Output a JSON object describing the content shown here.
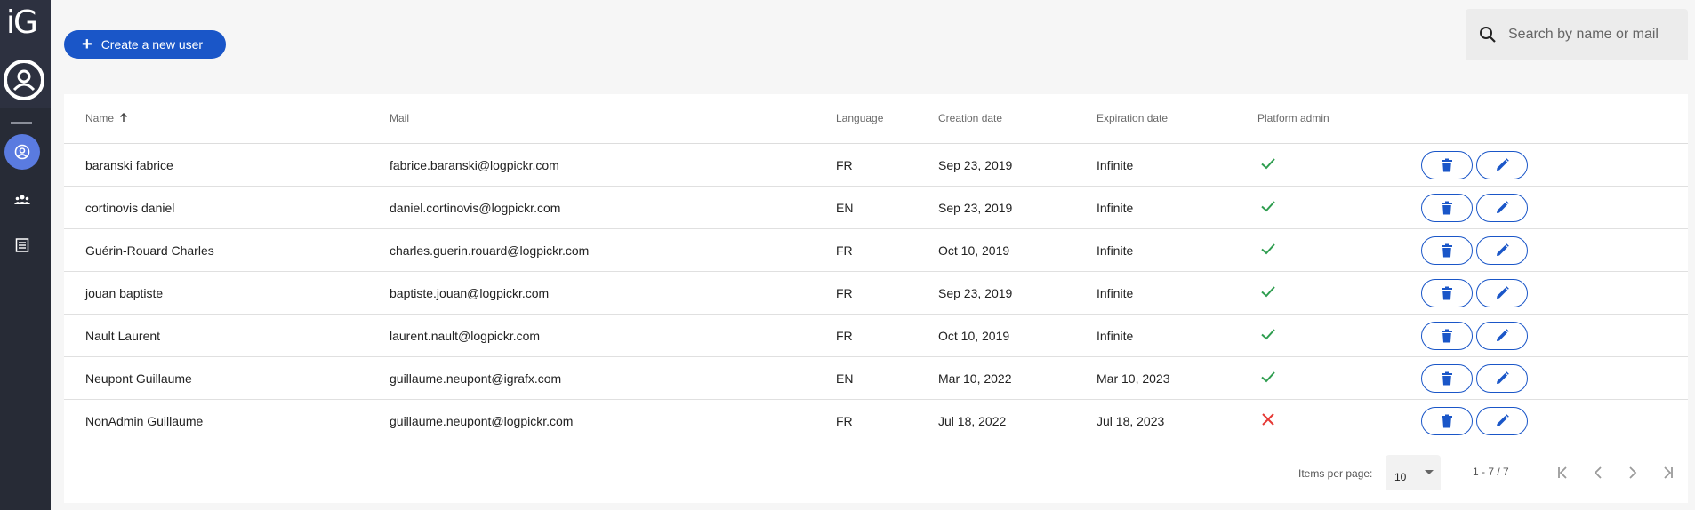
{
  "sidebar": {
    "logo": "iG",
    "items": [
      {
        "icon": "user-circle-icon",
        "active": true
      },
      {
        "icon": "group-icon",
        "active": false
      },
      {
        "icon": "list-icon",
        "active": false
      }
    ]
  },
  "toolbar": {
    "create_label": "Create a new user",
    "search_placeholder": "Search by name or mail"
  },
  "table": {
    "headers": {
      "name": "Name",
      "mail": "Mail",
      "language": "Language",
      "creation": "Creation date",
      "expiration": "Expiration date",
      "admin": "Platform admin"
    },
    "sort": {
      "column": "name",
      "direction": "asc"
    },
    "rows": [
      {
        "name": "baranski fabrice",
        "mail": "fabrice.baranski@logpickr.com",
        "language": "FR",
        "creation": "Sep 23, 2019",
        "expiration": "Infinite",
        "admin": true
      },
      {
        "name": "cortinovis daniel",
        "mail": "daniel.cortinovis@logpickr.com",
        "language": "EN",
        "creation": "Sep 23, 2019",
        "expiration": "Infinite",
        "admin": true
      },
      {
        "name": "Guérin-Rouard Charles",
        "mail": "charles.guerin.rouard@logpickr.com",
        "language": "FR",
        "creation": "Oct 10, 2019",
        "expiration": "Infinite",
        "admin": true
      },
      {
        "name": "jouan baptiste",
        "mail": "baptiste.jouan@logpickr.com",
        "language": "FR",
        "creation": "Sep 23, 2019",
        "expiration": "Infinite",
        "admin": true
      },
      {
        "name": "Nault Laurent",
        "mail": "laurent.nault@logpickr.com",
        "language": "FR",
        "creation": "Oct 10, 2019",
        "expiration": "Infinite",
        "admin": true
      },
      {
        "name": "Neupont Guillaume",
        "mail": "guillaume.neupont@igrafx.com",
        "language": "EN",
        "creation": "Mar 10, 2022",
        "expiration": "Mar 10, 2023",
        "admin": true
      },
      {
        "name": "NonAdmin Guillaume",
        "mail": "guillaume.neupont@logpickr.com",
        "language": "FR",
        "creation": "Jul 18, 2022",
        "expiration": "Jul 18, 2023",
        "admin": false
      }
    ]
  },
  "paginator": {
    "items_per_page_label": "Items per page:",
    "items_per_page": "10",
    "range": "1 - 7 / 7"
  },
  "colors": {
    "accent": "#1a56c8",
    "check": "#2e9d4f",
    "cross": "#e53935",
    "sidebar": "#272b36"
  }
}
